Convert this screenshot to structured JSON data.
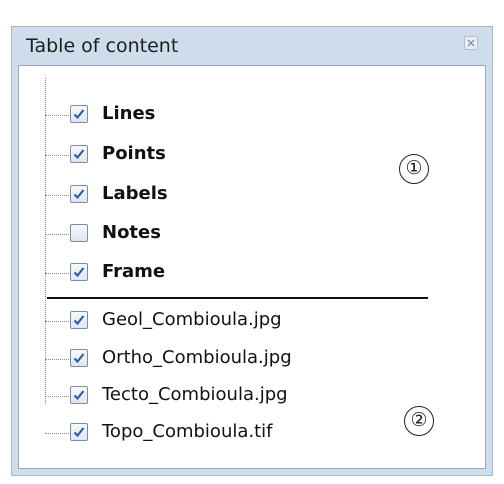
{
  "panel": {
    "title": "Table of content",
    "close_icon": "close-icon"
  },
  "layers": [
    {
      "label": "Lines",
      "checked": true,
      "bold": true
    },
    {
      "label": "Points",
      "checked": true,
      "bold": true
    },
    {
      "label": "Labels",
      "checked": true,
      "bold": true
    },
    {
      "label": "Notes",
      "checked": false,
      "bold": true
    },
    {
      "label": "Frame",
      "checked": true,
      "bold": true
    }
  ],
  "raster_layers": [
    {
      "label": "Geol_Combioula.jpg",
      "checked": true
    },
    {
      "label": "Ortho_Combioula.jpg",
      "checked": true
    },
    {
      "label": "Tecto_Combioula.jpg",
      "checked": true
    },
    {
      "label": "Topo_Combioula.tif",
      "checked": true
    }
  ],
  "annotations": {
    "group1": "①",
    "group2": "②"
  },
  "colors": {
    "panel_bg": "#cfdcec",
    "check_blue": "#2b5ea8"
  }
}
